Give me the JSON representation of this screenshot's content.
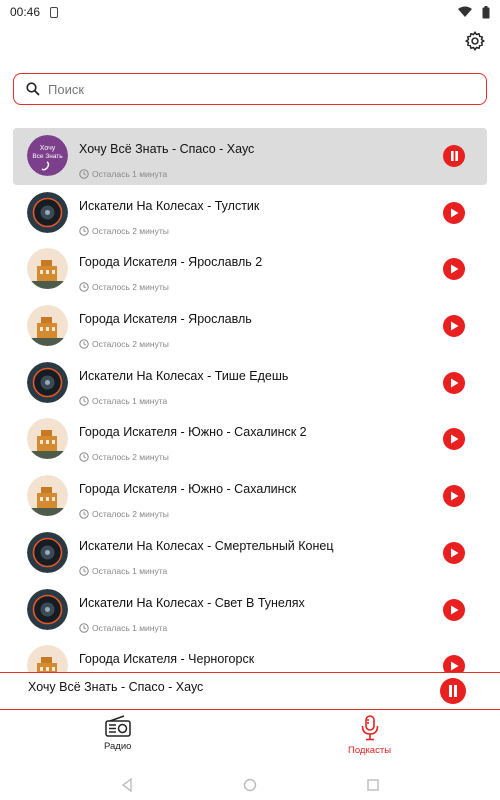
{
  "status_bar": {
    "time": "00:46"
  },
  "search": {
    "placeholder": "Поиск"
  },
  "list": {
    "items": [
      {
        "title": "Хочу Всё Знать -  Спасо - Хаус",
        "remaining": "Осталась 1 минута",
        "art": "vse",
        "state": "paused-active"
      },
      {
        "title": "Искатели На Колесах - Тулстик",
        "remaining": "Осталось 2 минуты",
        "art": "wheel",
        "state": "play"
      },
      {
        "title": "Города Искателя - Ярославль 2",
        "remaining": "Осталось 2 минуты",
        "art": "city",
        "state": "play"
      },
      {
        "title": "Города Искателя - Ярославль",
        "remaining": "Осталось 2 минуты",
        "art": "city",
        "state": "play"
      },
      {
        "title": "Искатели На Колесах - Тише Едешь",
        "remaining": "Осталась 1 минута",
        "art": "wheel",
        "state": "play"
      },
      {
        "title": "Города Искателя - Южно - Сахалинск 2",
        "remaining": "Осталось 2 минуты",
        "art": "city",
        "state": "play"
      },
      {
        "title": "Города Искателя - Южно - Сахалинск",
        "remaining": "Осталось 2 минуты",
        "art": "city",
        "state": "play"
      },
      {
        "title": "Искатели На Колесах - Смертельный Конец",
        "remaining": "Осталась 1 минута",
        "art": "wheel",
        "state": "play"
      },
      {
        "title": "Искатели На Колесах - Свет В Тунелях",
        "remaining": "Осталась 1 минута",
        "art": "wheel",
        "state": "play"
      },
      {
        "title": "Города Искателя - Черногорск",
        "remaining": "",
        "art": "city",
        "state": "play"
      }
    ]
  },
  "now_playing": {
    "title": "Хочу Всё Знать -  Спасо - Хаус"
  },
  "bottom_nav": {
    "radio_label": "Радио",
    "podcasts_label": "Подкасты",
    "active": "podcasts"
  },
  "art": {
    "vse_line1": "Хочу",
    "vse_line2": "Все Знать"
  },
  "colors": {
    "accent": "#e8201f",
    "active_row": "#dcdcdc",
    "muted_text": "#888888"
  },
  "icons": {
    "settings": "gear-icon",
    "search": "search-icon",
    "play": "play-icon",
    "pause": "pause-icon",
    "clock": "clock-icon",
    "radio": "radio-icon",
    "podcasts": "microphone-icon"
  }
}
